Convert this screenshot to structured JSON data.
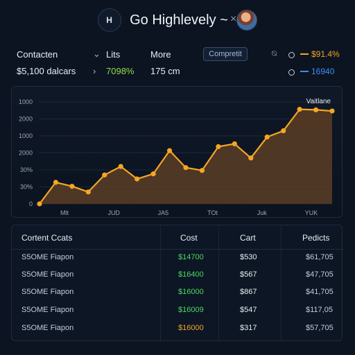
{
  "header": {
    "badge": "H",
    "title": "Go Highlevely ~",
    "close": "×"
  },
  "summary": {
    "left_label": "Contacten",
    "left_value": "$5,100 dalcars",
    "middle_label": "Lits",
    "middle_value": "7098%",
    "more_label": "More",
    "more_value": "175 cm",
    "compare_label": "Compretit",
    "right_top_value": "$91.4%",
    "right_bottom_value": "16940",
    "colors": {
      "green": "#8ee04a",
      "orange": "#f5a623",
      "blue": "#3b8ff0"
    }
  },
  "chart_data": {
    "type": "area",
    "legend": "Vaitlane",
    "legend_placement": "top-right",
    "y_tick_labels": [
      "1000",
      "2000",
      "1000",
      "2000",
      "30%",
      "30%",
      "0"
    ],
    "x_tick_labels": [
      "Mlt",
      "JUD",
      "JA5",
      "TOt",
      "Juk",
      "YUK"
    ],
    "x": [
      0,
      1,
      2,
      3,
      4,
      5,
      6,
      7,
      8,
      9,
      10,
      11,
      12,
      13,
      14,
      15,
      16,
      17,
      18
    ],
    "values": [
      0,
      190,
      155,
      105,
      255,
      330,
      220,
      265,
      470,
      320,
      295,
      505,
      530,
      405,
      590,
      645,
      835,
      830,
      820
    ],
    "ylim": [
      0,
      900
    ],
    "grid": true,
    "color": "#f5a623"
  },
  "table": {
    "headers": [
      "Cortent Ccats",
      "Cost",
      "Cart",
      "Pedicts"
    ],
    "rows": [
      [
        "S5OME Fiapon",
        "$14700",
        "$530",
        "$61,705"
      ],
      [
        "S5OME Fiapon",
        "$16400",
        "$567",
        "$47,705"
      ],
      [
        "S5OME Fiapon",
        "$16000",
        "$867",
        "$41,705"
      ],
      [
        "S5OME Fiapon",
        "$16009",
        "$547",
        "$117,05"
      ],
      [
        "S5OME Fiapon",
        "$16000",
        "$317",
        "$57,705"
      ]
    ],
    "cost_colors": [
      "#4cd964",
      "#4cd964",
      "#4cd964",
      "#4cd964",
      "#f5a623"
    ]
  }
}
